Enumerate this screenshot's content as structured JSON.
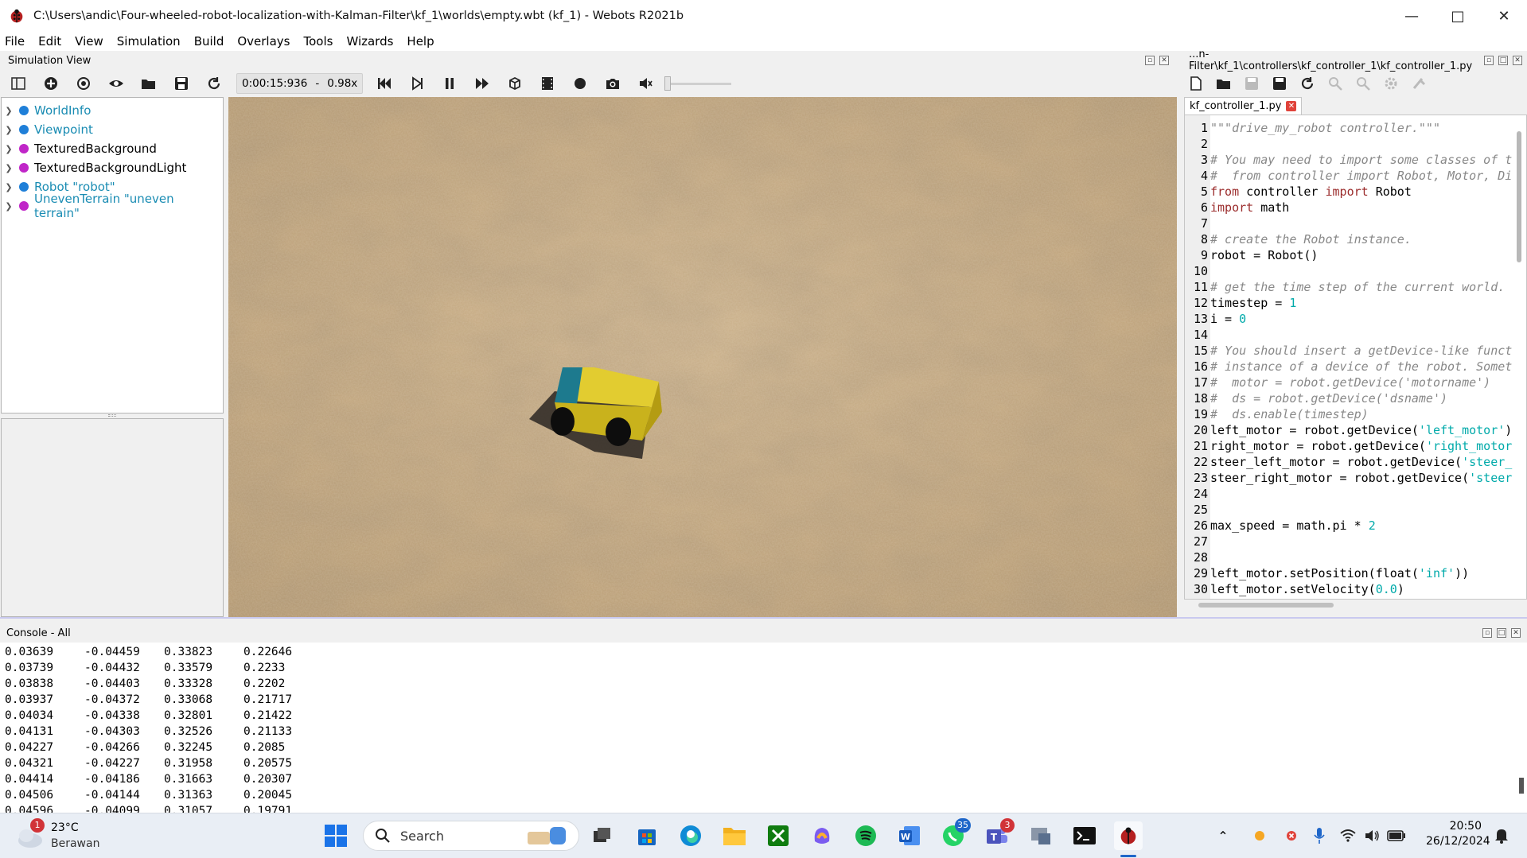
{
  "window": {
    "title": "C:\\Users\\andic\\Four-wheeled-robot-localization-with-Kalman-Filter\\kf_1\\worlds\\empty.wbt (kf_1) - Webots R2021b"
  },
  "menu": [
    "File",
    "Edit",
    "View",
    "Simulation",
    "Build",
    "Overlays",
    "Tools",
    "Wizards",
    "Help"
  ],
  "simulation_view": {
    "title": "Simulation View",
    "time": "0:00:15:936",
    "separator": "-",
    "speed": "0.98x"
  },
  "scene_tree": [
    {
      "label": "WorldInfo",
      "color": "#1a8cb3",
      "dot": "#1f7fd8"
    },
    {
      "label": "Viewpoint",
      "color": "#1a8cb3",
      "dot": "#1f7fd8"
    },
    {
      "label": "TexturedBackground",
      "color": "#000000",
      "dot": "#c026c8"
    },
    {
      "label": "TexturedBackgroundLight",
      "color": "#000000",
      "dot": "#c026c8"
    },
    {
      "label": "Robot \"robot\"",
      "color": "#1a8cb3",
      "dot": "#1f7fd8"
    },
    {
      "label": "UnevenTerrain \"uneven terrain\"",
      "color": "#1a8cb3",
      "dot": "#c026c8"
    }
  ],
  "editor": {
    "path": "...n-Filter\\kf_1\\controllers\\kf_controller_1\\kf_controller_1.py",
    "tab": "kf_controller_1.py",
    "lines": [
      {
        "n": "1",
        "t": "\"\"\"drive_my_robot controller.\"\"\""
      },
      {
        "n": "2",
        "t": ""
      },
      {
        "n": "3",
        "t": "# You may need to import some classes of t"
      },
      {
        "n": "4",
        "t": "#  from controller import Robot, Motor, Di"
      },
      {
        "n": "5",
        "t": "from controller import Robot"
      },
      {
        "n": "6",
        "t": "import math"
      },
      {
        "n": "7",
        "t": ""
      },
      {
        "n": "8",
        "t": "# create the Robot instance."
      },
      {
        "n": "9",
        "t": "robot = Robot()"
      },
      {
        "n": "10",
        "t": ""
      },
      {
        "n": "11",
        "t": "# get the time step of the current world."
      },
      {
        "n": "12",
        "t": "timestep = 1"
      },
      {
        "n": "13",
        "t": "i = 0"
      },
      {
        "n": "14",
        "t": ""
      },
      {
        "n": "15",
        "t": "# You should insert a getDevice-like funct"
      },
      {
        "n": "16",
        "t": "# instance of a device of the robot. Somet"
      },
      {
        "n": "17",
        "t": "#  motor = robot.getDevice('motorname')"
      },
      {
        "n": "18",
        "t": "#  ds = robot.getDevice('dsname')"
      },
      {
        "n": "19",
        "t": "#  ds.enable(timestep)"
      },
      {
        "n": "20",
        "t": "left_motor = robot.getDevice('left_motor')"
      },
      {
        "n": "21",
        "t": "right_motor = robot.getDevice('right_motor"
      },
      {
        "n": "22",
        "t": "steer_left_motor = robot.getDevice('steer_"
      },
      {
        "n": "23",
        "t": "steer_right_motor = robot.getDevice('steer"
      },
      {
        "n": "24",
        "t": ""
      },
      {
        "n": "25",
        "t": ""
      },
      {
        "n": "26",
        "t": "max_speed = math.pi * 2"
      },
      {
        "n": "27",
        "t": ""
      },
      {
        "n": "28",
        "t": ""
      },
      {
        "n": "29",
        "t": "left_motor.setPosition(float('inf'))"
      },
      {
        "n": "30",
        "t": "left_motor.setVelocity(0.0)"
      }
    ]
  },
  "console": {
    "title": "Console - All",
    "rows": [
      [
        "0.03639",
        "-0.04459",
        "0.33823",
        "0.22646"
      ],
      [
        "0.03739",
        "-0.04432",
        "0.33579",
        "0.2233"
      ],
      [
        "0.03838",
        "-0.04403",
        "0.33328",
        "0.2202"
      ],
      [
        "0.03937",
        "-0.04372",
        "0.33068",
        "0.21717"
      ],
      [
        "0.04034",
        "-0.04338",
        "0.32801",
        "0.21422"
      ],
      [
        "0.04131",
        "-0.04303",
        "0.32526",
        "0.21133"
      ],
      [
        "0.04227",
        "-0.04266",
        "0.32245",
        "0.2085"
      ],
      [
        "0.04321",
        "-0.04227",
        "0.31958",
        "0.20575"
      ],
      [
        "0.04414",
        "-0.04186",
        "0.31663",
        "0.20307"
      ],
      [
        "0.04506",
        "-0.04144",
        "0.31363",
        "0.20045"
      ],
      [
        "0.04596",
        "-0.04099",
        "0.31057",
        "0.19791"
      ]
    ]
  },
  "taskbar": {
    "weather_temp": "23°C",
    "weather_desc": "Berawan",
    "weather_badge": "1",
    "search_placeholder": "Search",
    "whatsapp_badge": "35",
    "teams_badge": "3",
    "time": "20:50",
    "date": "26/12/2024"
  }
}
